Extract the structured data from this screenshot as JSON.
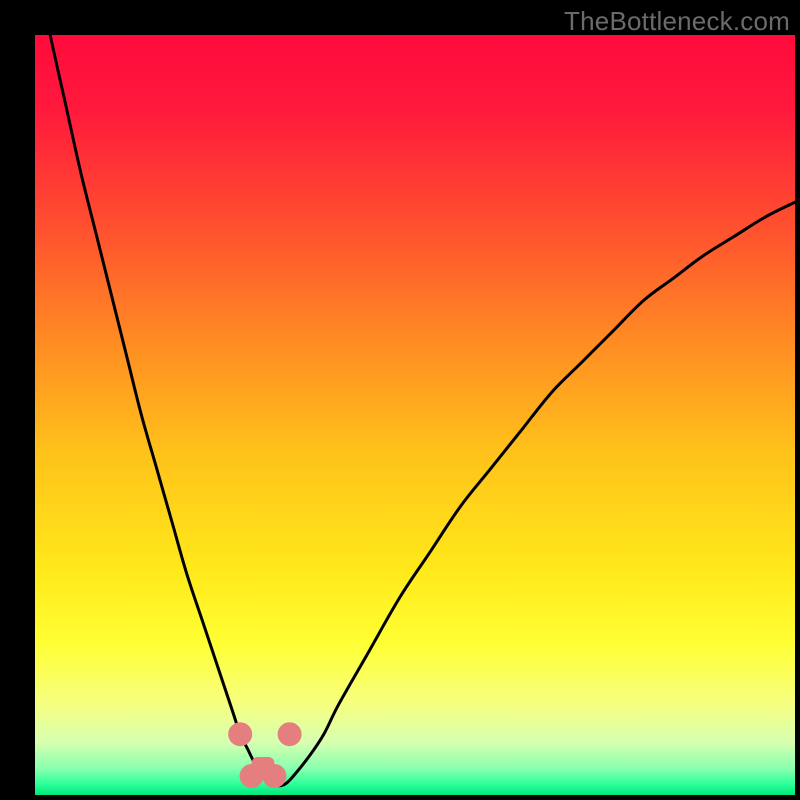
{
  "watermark": {
    "text": "TheBottleneck.com"
  },
  "chart_data": {
    "type": "line",
    "title": "",
    "xlabel": "",
    "ylabel": "",
    "xlim": [
      0,
      100
    ],
    "ylim": [
      0,
      100
    ],
    "grid": false,
    "legend": false,
    "x": [
      0,
      2,
      4,
      6,
      8,
      10,
      12,
      14,
      16,
      18,
      20,
      22,
      24,
      26,
      27,
      28,
      29,
      30,
      31,
      32,
      33,
      34,
      36,
      38,
      40,
      44,
      48,
      52,
      56,
      60,
      64,
      68,
      72,
      76,
      80,
      84,
      88,
      92,
      96,
      100
    ],
    "values": [
      110,
      100,
      91,
      82,
      74,
      66,
      58,
      50,
      43,
      36,
      29,
      23,
      17,
      11,
      8,
      6,
      4,
      2.5,
      1.5,
      1.2,
      1.5,
      2.5,
      5,
      8,
      12,
      19,
      26,
      32,
      38,
      43,
      48,
      53,
      57,
      61,
      65,
      68,
      71,
      73.5,
      76,
      78
    ],
    "background_gradient": {
      "stops": [
        {
          "pos": 0.0,
          "color": "#ff0b3c"
        },
        {
          "pos": 0.1,
          "color": "#ff1a3c"
        },
        {
          "pos": 0.25,
          "color": "#ff4f2f"
        },
        {
          "pos": 0.4,
          "color": "#ff8a23"
        },
        {
          "pos": 0.55,
          "color": "#ffc21a"
        },
        {
          "pos": 0.7,
          "color": "#ffe81a"
        },
        {
          "pos": 0.8,
          "color": "#ffff33"
        },
        {
          "pos": 0.88,
          "color": "#f6ff80"
        },
        {
          "pos": 0.93,
          "color": "#d8ffb0"
        },
        {
          "pos": 0.965,
          "color": "#8affb0"
        },
        {
          "pos": 0.985,
          "color": "#2fff9c"
        },
        {
          "pos": 1.0,
          "color": "#00e878"
        }
      ]
    },
    "markers": [
      {
        "x": 27.0,
        "y": 8.0,
        "color": "#e57e7e",
        "r": 12
      },
      {
        "x": 33.5,
        "y": 8.0,
        "color": "#e57e7e",
        "r": 12
      },
      {
        "x": 28.5,
        "y": 2.5,
        "color": "#e57e7e",
        "r": 12
      },
      {
        "x": 31.5,
        "y": 2.5,
        "color": "#e57e7e",
        "r": 12
      }
    ],
    "valley_bar": {
      "x0": 28.5,
      "x1": 31.5,
      "y": 2.0,
      "height": 3.0,
      "color": "#e57e7e"
    },
    "curve_color": "#000000",
    "curve_width": 3
  }
}
